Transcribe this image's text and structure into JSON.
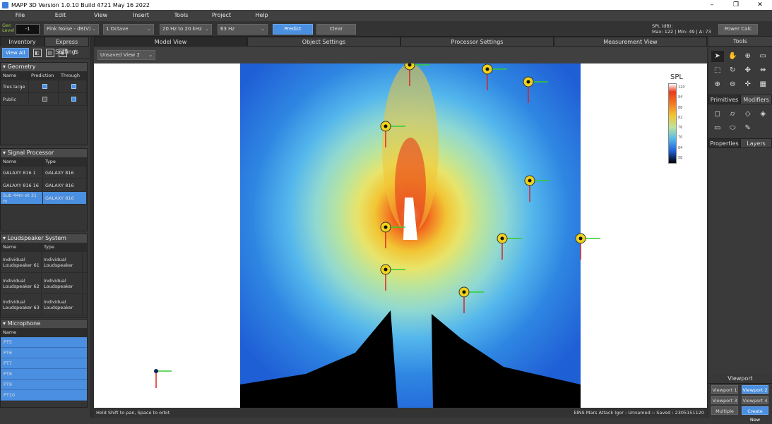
{
  "window": {
    "title": "MAPP 3D Version 1.0.10 Build 4721 May 16 2022"
  },
  "menu": [
    "File",
    "Edit",
    "View",
    "Insert",
    "Tools",
    "Project",
    "Help"
  ],
  "toolbar": {
    "gen_label": "Gen Level",
    "gen_value": "-1",
    "signal": "Pink Noise - dB(V)",
    "bandwidth": "1 Octave",
    "range": "20 Hz to 20 kHz",
    "frequency": "63 Hz",
    "predict": "Predict",
    "clear": "Clear",
    "spl_label": "SPL (dB):",
    "spl_stats": "Max: 122 | Min: 49 | Δ: 73",
    "power_calc": "Power Calc"
  },
  "left": {
    "tabs": [
      "Inventory",
      "Express Settings"
    ],
    "view_all": "View All",
    "geometry": {
      "title": "Geometry",
      "headers": [
        "Name",
        "Prediction",
        "Through"
      ],
      "rows": [
        {
          "name": "Tres large",
          "prediction": true,
          "through": true
        },
        {
          "name": "Public",
          "prediction": false,
          "through": true
        }
      ]
    },
    "signal_processor": {
      "title": "Signal Processor",
      "headers": [
        "Name",
        "Type"
      ],
      "rows": [
        {
          "name": "GALAXY 816 1",
          "type": "GALAXY 816"
        },
        {
          "name": "GALAXY 816 16",
          "type": "GALAXY 816"
        },
        {
          "name": "Sub 44m et 31 m",
          "type": "GALAXY 816",
          "selected": true
        }
      ]
    },
    "loudspeaker_system": {
      "title": "Loudspeaker System",
      "headers": [
        "Name",
        "Type"
      ],
      "rows": [
        {
          "name": "Individual Loudspeaker 61",
          "type": "Individual Loudspeaker"
        },
        {
          "name": "Individual Loudspeaker 62",
          "type": "Individual Loudspeaker"
        },
        {
          "name": "Individual Loudspeaker 63",
          "type": "Individual Loudspeaker"
        }
      ]
    },
    "microphone": {
      "title": "Microphone",
      "header": "Name",
      "rows": [
        "PT5",
        "PT6",
        "PT7",
        "PT8",
        "PT9",
        "PT10"
      ]
    }
  },
  "center": {
    "tabs": [
      "Model View",
      "Object Settings",
      "Processor Settings",
      "Measurement View"
    ],
    "view_select": "Unsaved View 2",
    "legend_title": "SPL",
    "legend_ticks": [
      "120",
      "94",
      "88",
      "82",
      "76",
      "70",
      "64",
      "58"
    ],
    "status_left": "Hold Shift to pan, Space to orbit",
    "status_right": "EINS Mars Attack Igor : Unnamed :: Saved : 2305151120"
  },
  "right": {
    "tools_title": "Tools",
    "tabs_a": [
      "Primitives",
      "Modifiers"
    ],
    "tabs_b": [
      "Properties",
      "Layers"
    ],
    "viewport_title": "Viewport",
    "viewport_buttons": [
      "Viewport 1",
      "Viewport 2",
      "Viewport 3",
      "Viewport 4",
      "Multiple",
      "Create New"
    ]
  }
}
